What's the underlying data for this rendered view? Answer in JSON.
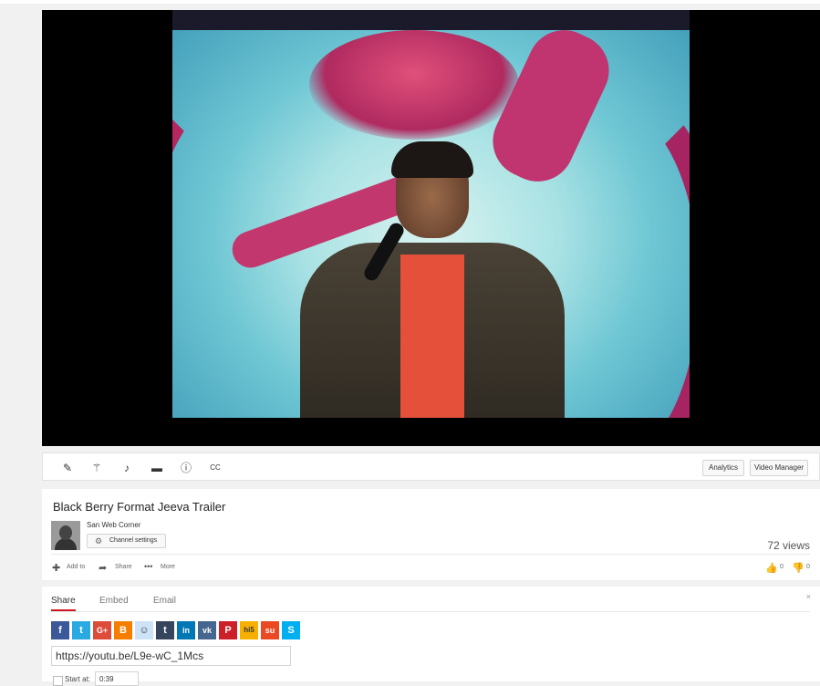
{
  "video": {
    "title": "Black Berry Format Jeeva Trailer"
  },
  "toolbar": {
    "icons": [
      "pencil-icon",
      "magic-wand-icon",
      "music-note-icon",
      "annotations-icon",
      "info-icon",
      "captions-icon"
    ],
    "analytics_label": "Analytics",
    "video_manager_label": "Video Manager"
  },
  "channel": {
    "name": "San Web Corner",
    "settings_label": "Channel settings"
  },
  "stats": {
    "views": "72 views",
    "likes": "0",
    "dislikes": "0"
  },
  "actions": {
    "add_to": "Add to",
    "share": "Share",
    "more": "More"
  },
  "share_panel": {
    "tabs": [
      "Share",
      "Embed",
      "Email"
    ],
    "active_tab": "Share",
    "close": "×",
    "social": [
      {
        "name": "facebook",
        "glyph": "f",
        "color": "#3b5998"
      },
      {
        "name": "twitter",
        "glyph": "t",
        "color": "#2ba9e1"
      },
      {
        "name": "google-plus",
        "glyph": "G+",
        "color": "#dd4b39"
      },
      {
        "name": "blogger",
        "glyph": "B",
        "color": "#f57d00"
      },
      {
        "name": "reddit",
        "glyph": "☺",
        "color": "#cee3f8"
      },
      {
        "name": "tumblr",
        "glyph": "t",
        "color": "#35465c"
      },
      {
        "name": "linkedin",
        "glyph": "in",
        "color": "#0077b5"
      },
      {
        "name": "vk",
        "glyph": "vk",
        "color": "#45668e"
      },
      {
        "name": "pinterest",
        "glyph": "P",
        "color": "#cb2027"
      },
      {
        "name": "hi5",
        "glyph": "hi5",
        "color": "#f8b000"
      },
      {
        "name": "stumbleupon",
        "glyph": "su",
        "color": "#eb4924"
      },
      {
        "name": "skype",
        "glyph": "S",
        "color": "#00aff0"
      }
    ],
    "url": "https://youtu.be/L9e-wC_1Mcs",
    "start_at_label": "Start at:",
    "start_at_value": "0:39"
  }
}
